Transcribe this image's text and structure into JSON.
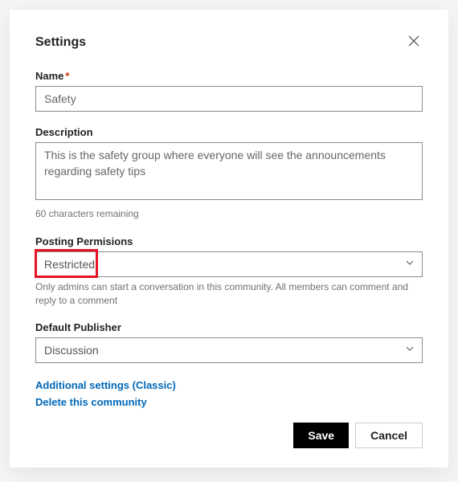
{
  "dialog": {
    "title": "Settings",
    "fields": {
      "name": {
        "label": "Name",
        "value": "Safety"
      },
      "description": {
        "label": "Description",
        "value": "This is the safety group where everyone will see the announcements regarding safety tips",
        "helper": "60 characters remaining"
      },
      "posting": {
        "label": "Posting Permisions",
        "value": "Restricted",
        "helper": "Only admins can start a conversation in this community. All members can comment and reply to a comment"
      },
      "publisher": {
        "label": "Default Publisher",
        "value": "Discussion"
      }
    },
    "links": {
      "additional": "Additional settings (Classic)",
      "delete": "Delete this community"
    },
    "buttons": {
      "save": "Save",
      "cancel": "Cancel"
    }
  }
}
